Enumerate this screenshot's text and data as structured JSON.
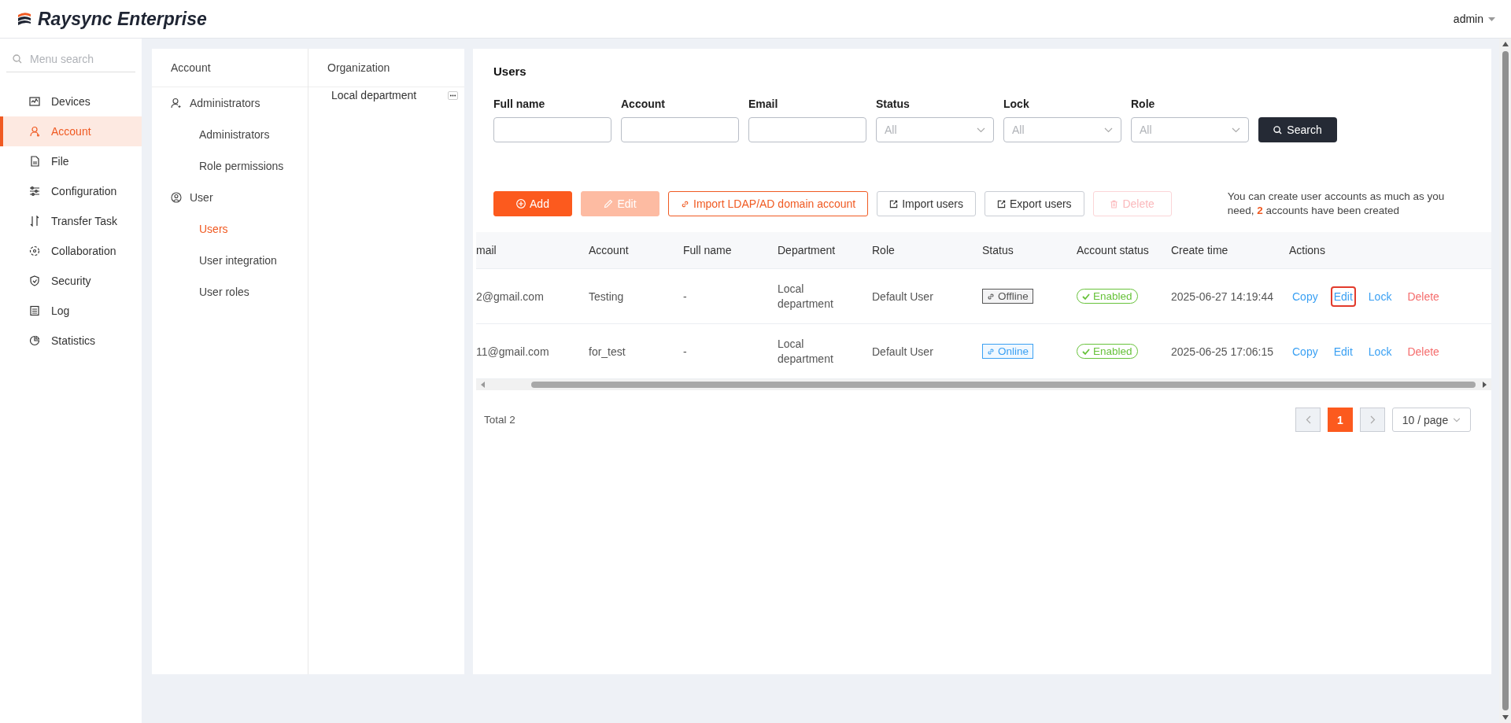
{
  "header": {
    "logo_text": "Raysync Enterprise",
    "user": "admin"
  },
  "sidebar": {
    "search_placeholder": "Menu search",
    "items": [
      {
        "label": "Devices",
        "selected": false
      },
      {
        "label": "Account",
        "selected": true
      },
      {
        "label": "File",
        "selected": false
      },
      {
        "label": "Configuration",
        "selected": false
      },
      {
        "label": "Transfer Task",
        "selected": false
      },
      {
        "label": "Collaboration",
        "selected": false
      },
      {
        "label": "Security",
        "selected": false
      },
      {
        "label": "Log",
        "selected": false
      },
      {
        "label": "Statistics",
        "selected": false
      }
    ]
  },
  "account_menu": {
    "title": "Account",
    "groups": [
      {
        "label": "Administrators",
        "children": [
          {
            "label": "Administrators",
            "selected": false
          },
          {
            "label": "Role permissions",
            "selected": false
          }
        ]
      },
      {
        "label": "User",
        "children": [
          {
            "label": "Users",
            "selected": true
          },
          {
            "label": "User integration",
            "selected": false
          },
          {
            "label": "User roles",
            "selected": false
          }
        ]
      }
    ]
  },
  "organization": {
    "title": "Organization",
    "items": [
      {
        "label": "Local department"
      }
    ]
  },
  "main": {
    "title": "Users",
    "filters": [
      {
        "label": "Full name",
        "kind": "input"
      },
      {
        "label": "Account",
        "kind": "input"
      },
      {
        "label": "Email",
        "kind": "input"
      },
      {
        "label": "Status",
        "kind": "select",
        "placeholder": "All"
      },
      {
        "label": "Lock",
        "kind": "select",
        "placeholder": "All"
      },
      {
        "label": "Role",
        "kind": "select",
        "placeholder": "All"
      }
    ],
    "search_button": "Search",
    "toolbar": [
      {
        "label": "Add",
        "kind": "primary",
        "disabled": false
      },
      {
        "label": "Edit",
        "kind": "primary",
        "disabled": true
      },
      {
        "label": "Import LDAP/AD domain account",
        "kind": "outline",
        "disabled": false
      },
      {
        "label": "Import users",
        "kind": "default",
        "disabled": false
      },
      {
        "label": "Export users",
        "kind": "default",
        "disabled": false
      },
      {
        "label": "Delete",
        "kind": "danger",
        "disabled": true
      }
    ],
    "note": "You can create user accounts as much as you need, **2** accounts have been created",
    "table": {
      "columns": [
        "mail",
        "Account",
        "Full name",
        "Department",
        "Role",
        "Status",
        "Account status",
        "Create time",
        "Actions"
      ],
      "rows": [
        {
          "email": "2@gmail.com",
          "account": "Testing",
          "full_name": "-",
          "department": "Local department",
          "role": "Default User",
          "status": {
            "label": "Offline",
            "kind": "offline"
          },
          "account_status": "Enabled",
          "create_time": "2025-06-27 14:19:44",
          "actions": [
            {
              "label": "Copy",
              "kind": "link",
              "highlighted": false
            },
            {
              "label": "Edit",
              "kind": "link",
              "highlighted": true
            },
            {
              "label": "Lock",
              "kind": "link",
              "highlighted": false
            },
            {
              "label": "Delete",
              "kind": "danger",
              "highlighted": false
            }
          ]
        },
        {
          "email": "11@gmail.com",
          "account": "for_test",
          "full_name": "-",
          "department": "Local department",
          "role": "Default User",
          "status": {
            "label": "Online",
            "kind": "online"
          },
          "account_status": "Enabled",
          "create_time": "2025-06-25 17:06:15",
          "actions": [
            {
              "label": "Copy",
              "kind": "link",
              "highlighted": false
            },
            {
              "label": "Edit",
              "kind": "link",
              "highlighted": false
            },
            {
              "label": "Lock",
              "kind": "link",
              "highlighted": false
            },
            {
              "label": "Delete",
              "kind": "danger",
              "highlighted": false
            }
          ]
        }
      ]
    },
    "pagination": {
      "total": "Total 2",
      "pages": [
        {
          "label": "1",
          "selected": true
        }
      ],
      "page_size": "10 / page"
    }
  }
}
